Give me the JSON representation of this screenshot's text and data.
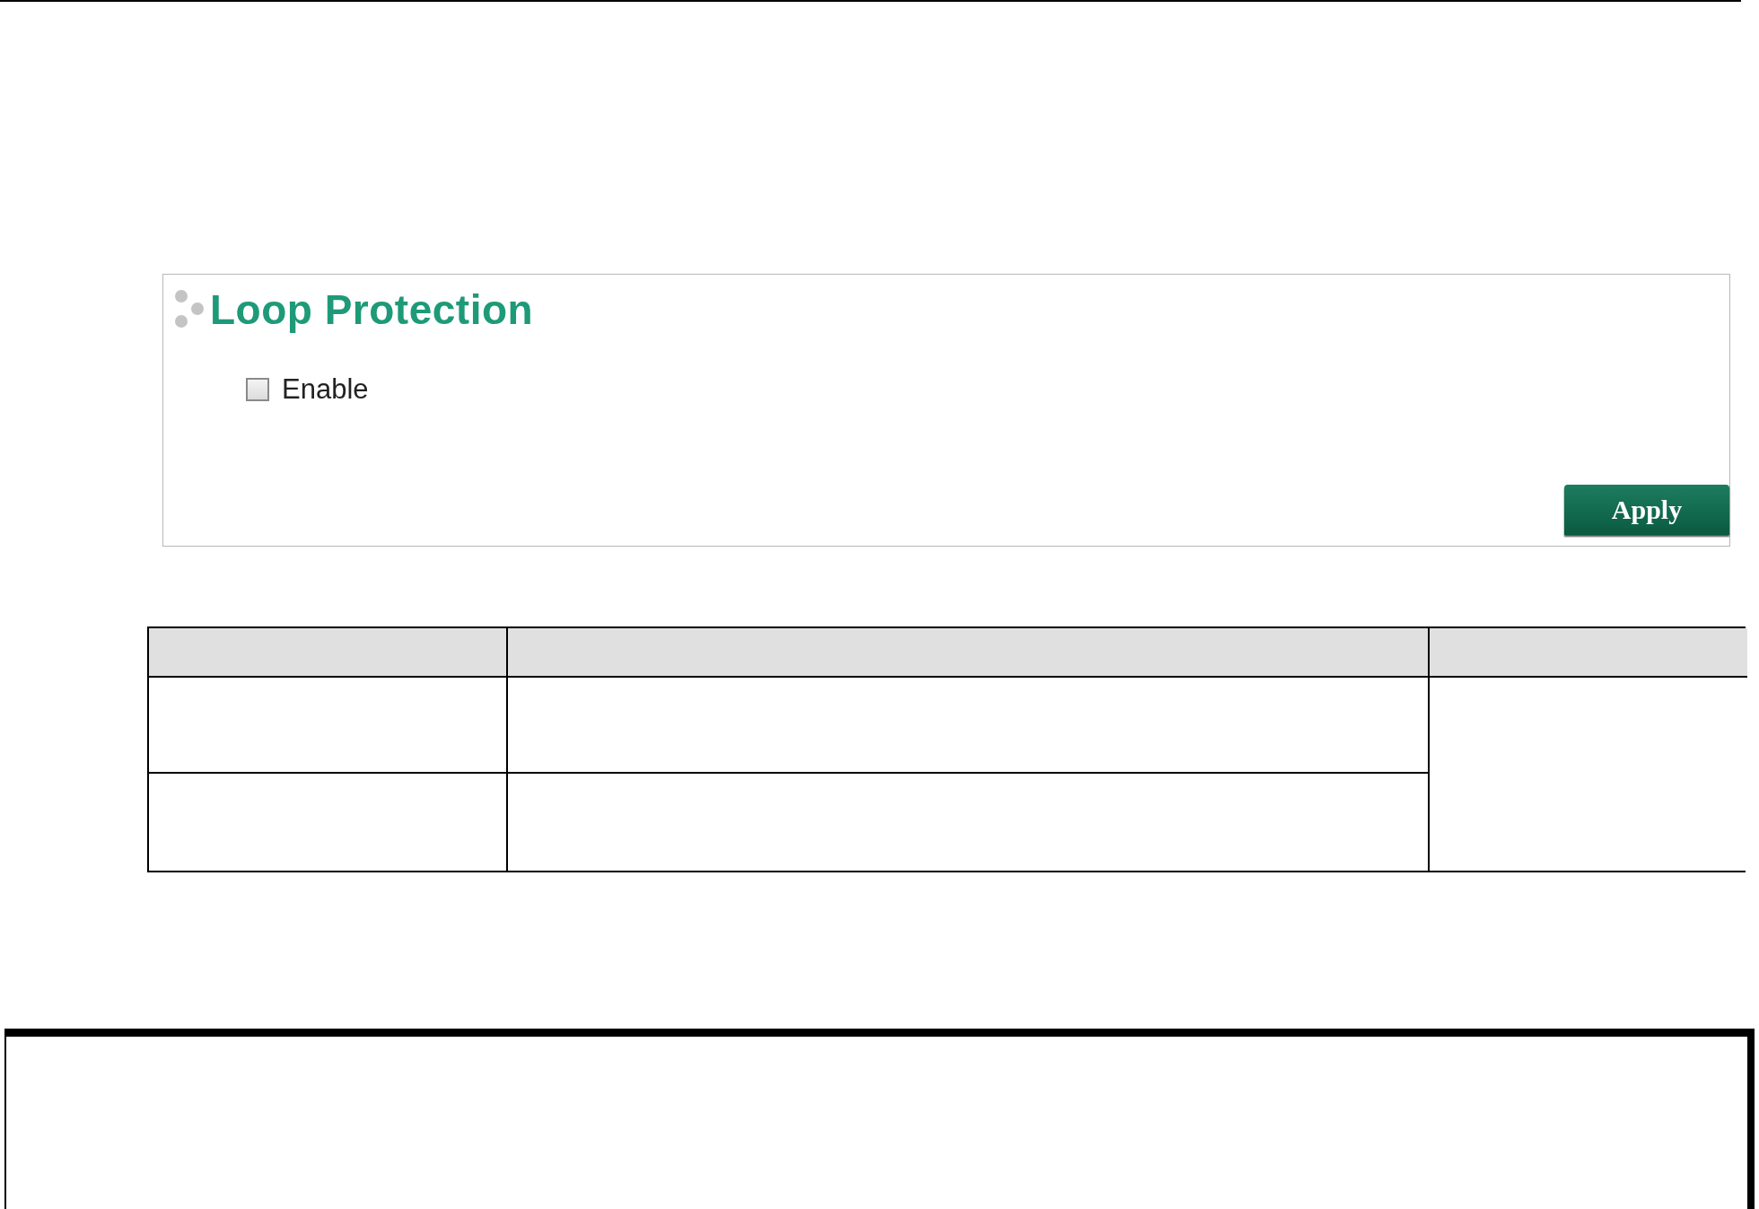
{
  "panel": {
    "title": "Loop Protection",
    "options": [
      {
        "kind": "checkbox",
        "label": "Enable",
        "checked": false
      }
    ],
    "buttons": [
      {
        "label": "Apply"
      }
    ]
  }
}
